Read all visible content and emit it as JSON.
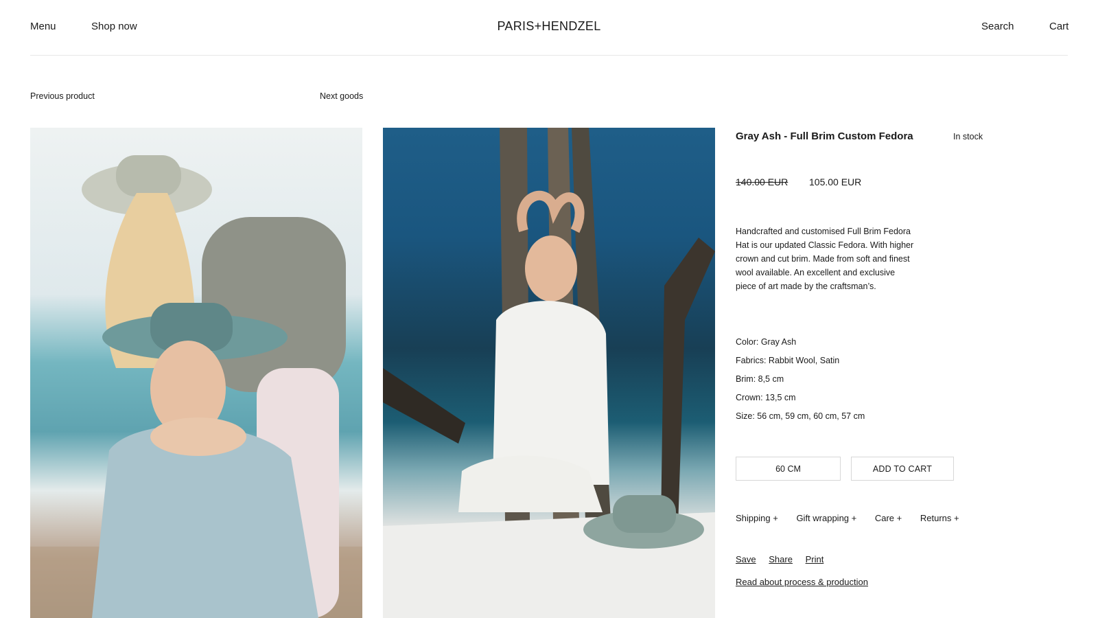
{
  "header": {
    "menu_label": "Menu",
    "shop_label": "Shop now",
    "brand": "PARIS+HENDZEL",
    "search_label": "Search",
    "cart_label": "Cart"
  },
  "pager": {
    "previous_label": "Previous product",
    "next_label": "Next goods"
  },
  "product": {
    "title": "Gray Ash - Full Brim Custom Fedora",
    "stock": "In stock",
    "old_price": "140.00 EUR",
    "new_price": "105.00 EUR",
    "description": "Handcrafted and customised Full Brim Fedora Hat is our updated Classic Fedora. With higher crown and cut brim. Made from soft and finest wool available. An excellent and exclusive piece of art made by the craftsman’s.",
    "specs": [
      "Color: Gray Ash",
      "Fabrics: Rabbit Wool, Satin",
      "Brim: 8,5 cm",
      "Crown: 13,5 cm",
      "Size: 56 cm, 59 cm, 60 cm, 57 cm"
    ],
    "selected_size": "60 CM",
    "add_to_cart": "ADD TO CART",
    "accordions": [
      "Shipping +",
      "Gift wrapping +",
      "Care +",
      "Returns +"
    ],
    "actions": [
      "Save",
      "Share",
      "Print"
    ],
    "process_link": "Read about process & production"
  },
  "colors": {
    "text": "#1a1a1a",
    "divider": "#e6e6e6",
    "button_border": "#d7d7d7"
  }
}
